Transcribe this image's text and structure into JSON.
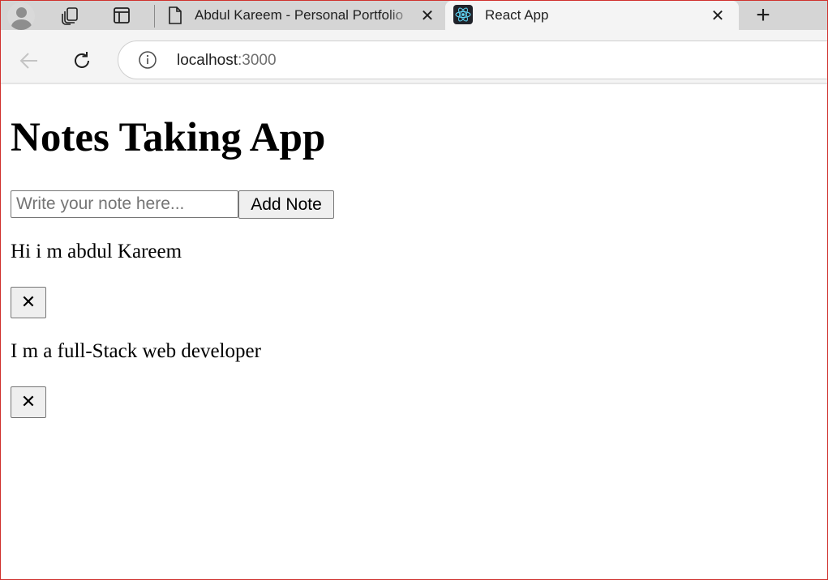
{
  "browser": {
    "tabs": [
      {
        "title": "Abdul Kareem - Personal Portfolio",
        "active": false,
        "icon": "document-icon"
      },
      {
        "title": "React App",
        "active": true,
        "icon": "react-logo-icon"
      }
    ],
    "close_glyph": "✕",
    "new_tab_glyph": "+",
    "address": {
      "host": "localhost",
      "port": ":3000"
    }
  },
  "app": {
    "title": "Notes Taking App",
    "input": {
      "value": "",
      "placeholder": "Write your note here..."
    },
    "add_button_label": "Add Note",
    "notes": [
      {
        "text": "Hi i m abdul Kareem",
        "delete_label": "✕"
      },
      {
        "text": "I m a full-Stack web developer",
        "delete_label": "✕"
      }
    ]
  },
  "colors": {
    "window_border": "#d0312d",
    "tabstrip_bg": "#d5d5d5",
    "active_tab_bg": "#f4f4f4",
    "react_accent": "#61dafb"
  }
}
